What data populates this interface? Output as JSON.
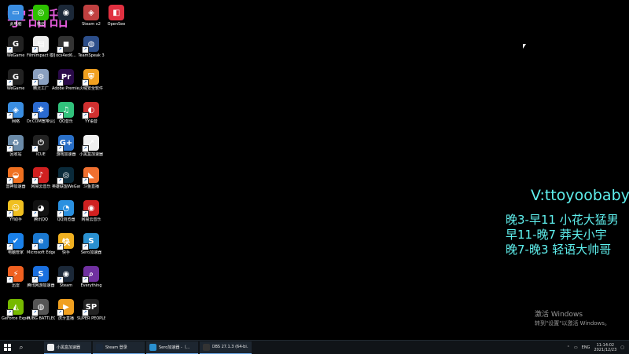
{
  "overlay": {
    "handle": "V:ttoyoobaby",
    "schedule": [
      "晚3-早11 小花大猛男",
      "早11-晚7 莽夫小宇",
      "晚7-晚3 轻语大帅哥"
    ],
    "pink_text": "宇甜甜",
    "color": "#5ff0ee",
    "pink_color": "#e05ad8"
  },
  "activation": {
    "title": "激活 Windows",
    "subtitle": "转到\"设置\"以激活 Windows。"
  },
  "desktop_icons": [
    {
      "label": "此电脑",
      "icon": "computer-icon",
      "color": "#3a8de0",
      "glyph": "▭"
    },
    {
      "label": "微信",
      "icon": "wechat-icon",
      "color": "#2dc100",
      "glyph": "◎"
    },
    {
      "label": "",
      "icon": "steam-icon",
      "color": "#1b2838",
      "glyph": "◉"
    },
    {
      "label": "Steam x2",
      "icon": "app-icon",
      "color": "#c04040",
      "glyph": "◈"
    },
    {
      "label": "OpenSee",
      "icon": "opensee-icon",
      "color": "#e03040",
      "glyph": "◧"
    },
    {
      "label": "WeGame",
      "icon": "wegame-icon",
      "color": "#222",
      "glyph": "G"
    },
    {
      "label": "FilmImpact 模板",
      "icon": "document-icon",
      "color": "#eee",
      "glyph": "▤"
    },
    {
      "label": "ocs4ed6...",
      "icon": "app-icon",
      "color": "#333",
      "glyph": "◼"
    },
    {
      "label": "TeamSpeak 3",
      "icon": "teamspeak-icon",
      "color": "#2c4e8a",
      "glyph": "◍"
    },
    {
      "label": "WeGame",
      "icon": "wegame-icon",
      "color": "#222",
      "glyph": "G"
    },
    {
      "label": "精灵工厂",
      "icon": "tool-icon",
      "color": "#8aa0c0",
      "glyph": "⚙"
    },
    {
      "label": "Adobe Premie...",
      "icon": "premiere-icon",
      "color": "#2a0a4a",
      "glyph": "Pr"
    },
    {
      "label": "火绒安全软件",
      "icon": "shield-icon",
      "color": "#f0a020",
      "glyph": "⛨"
    },
    {
      "label": "网络",
      "icon": "network-icon",
      "color": "#3a8de0",
      "glyph": "◈"
    },
    {
      "label": "Dr.COM宽带认证客户端",
      "icon": "drcom-icon",
      "color": "#2a6ad0",
      "glyph": "✱"
    },
    {
      "label": "QQ音乐",
      "icon": "qqmusic-icon",
      "color": "#31c27c",
      "glyph": "♫"
    },
    {
      "label": "YY语音",
      "icon": "yy-icon",
      "color": "#d03030",
      "glyph": "◐"
    },
    {
      "label": "回收站",
      "icon": "recycle-bin-icon",
      "color": "#6a8aa8",
      "glyph": "♻"
    },
    {
      "label": "iCUE",
      "icon": "icue-icon",
      "color": "#222",
      "glyph": "⏻"
    },
    {
      "label": "游戏加速器",
      "icon": "booster-icon",
      "color": "#2a70c8",
      "glyph": "G+"
    },
    {
      "label": "小黑盒加速器",
      "icon": "heybox-icon",
      "color": "#f0f0f0",
      "glyph": "↗"
    },
    {
      "label": "雷神加速器",
      "icon": "leigod-icon",
      "color": "#f07020",
      "glyph": "◒"
    },
    {
      "label": "网易云音乐",
      "icon": "music-icon",
      "color": "#d02020",
      "glyph": "♪"
    },
    {
      "label": "英雄联盟WeGame版",
      "icon": "lol-icon",
      "color": "#0a2a3a",
      "glyph": "◎"
    },
    {
      "label": "斗鱼直播",
      "icon": "douyu-icon",
      "color": "#f07030",
      "glyph": "◣"
    },
    {
      "label": "YY助手",
      "icon": "yy-assistant-icon",
      "color": "#f0c020",
      "glyph": "☺"
    },
    {
      "label": "腾讯QQ",
      "icon": "qq-icon",
      "color": "#111",
      "glyph": "◕"
    },
    {
      "label": "QQ浏览器",
      "icon": "qqbrowser-icon",
      "color": "#2a90e0",
      "glyph": "◔"
    },
    {
      "label": "网易云音乐",
      "icon": "netease-icon",
      "color": "#d02020",
      "glyph": "◉"
    },
    {
      "label": "电脑管家",
      "icon": "pcmgr-icon",
      "color": "#1a80e8",
      "glyph": "✔"
    },
    {
      "label": "Microsoft Edge",
      "icon": "edge-icon",
      "color": "#1a78d0",
      "glyph": "e"
    },
    {
      "label": "快手",
      "icon": "kuaishou-icon",
      "color": "#f0b020",
      "glyph": "快"
    },
    {
      "label": "Sero加速器",
      "icon": "sero-icon",
      "color": "#2a90d0",
      "glyph": "S"
    },
    {
      "label": "迅雷",
      "icon": "xunlei-icon",
      "color": "#f06020",
      "glyph": "⚡"
    },
    {
      "label": "腾讯网游加速器",
      "icon": "accelerator-icon",
      "color": "#1a70e0",
      "glyph": "S"
    },
    {
      "label": "Steam",
      "icon": "steam-icon",
      "color": "#1b2838",
      "glyph": "◉"
    },
    {
      "label": "Everything",
      "icon": "search-app-icon",
      "color": "#7030a0",
      "glyph": "⌕"
    },
    {
      "label": "GeForce Experience",
      "icon": "nvidia-icon",
      "color": "#76b900",
      "glyph": "◭"
    },
    {
      "label": "PUBG BATTLEGR...",
      "icon": "pubg-icon",
      "color": "#555",
      "glyph": "◍"
    },
    {
      "label": "虎牙直播",
      "icon": "huya-icon",
      "color": "#f0a020",
      "glyph": "▶"
    },
    {
      "label": "SUPER PEOPLE CB",
      "icon": "superpeople-icon",
      "color": "#222",
      "glyph": "SP"
    }
  ],
  "taskbar": {
    "apps": [
      {
        "label": "小黑盒加速器",
        "color": "#eee"
      },
      {
        "label": "Steam 登录",
        "color": "#1b2838"
      },
      {
        "label": "Sero加速器 -（...",
        "color": "#2a90d0"
      },
      {
        "label": "OBS 27.1.3 (64-bi...",
        "color": "#333"
      }
    ],
    "tray_language": "ENG",
    "time": "11:14:02",
    "date": "2021/12/23"
  }
}
